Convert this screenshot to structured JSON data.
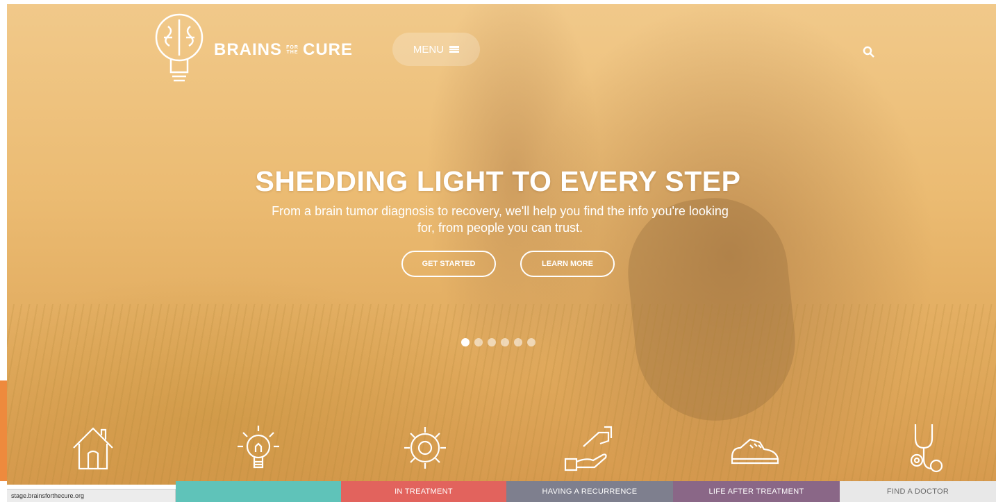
{
  "brand": {
    "name_left": "BRAINS",
    "name_small": "FOR THE",
    "name_right": "CURE"
  },
  "header": {
    "menu_label": "MENU",
    "search_icon": "search-icon"
  },
  "hero": {
    "headline": "SHEDDING LIGHT TO EVERY STEP",
    "subtext": "From a brain tumor diagnosis to recovery, we'll help you find the info you're looking for, from people you can trust.",
    "cta_primary": "GET STARTED",
    "cta_secondary": "LEARN MORE",
    "slides_total": 6,
    "slide_active": 1
  },
  "category_icons": [
    {
      "icon": "house-icon"
    },
    {
      "icon": "lightbulb-icon"
    },
    {
      "icon": "gear-icon"
    },
    {
      "icon": "helping-hand-icon"
    },
    {
      "icon": "sneaker-icon"
    },
    {
      "icon": "stethoscope-icon"
    }
  ],
  "bottom_nav": {
    "items": [
      {
        "label": ""
      },
      {
        "label": "IN TREATMENT"
      },
      {
        "label": "HAVING A RECURRENCE"
      },
      {
        "label": "LIFE AFTER TREATMENT"
      },
      {
        "label": "FIND A DOCTOR"
      }
    ]
  },
  "status_bar": {
    "url": "stage.brainsforthecure.org"
  },
  "colors": {
    "teal": "#5fc3b9",
    "red": "#e2635d",
    "slate": "#7e7f8e",
    "purple": "#8a6787",
    "light_gray": "#e8e8e8",
    "accent_orange": "#ee8a3d"
  }
}
